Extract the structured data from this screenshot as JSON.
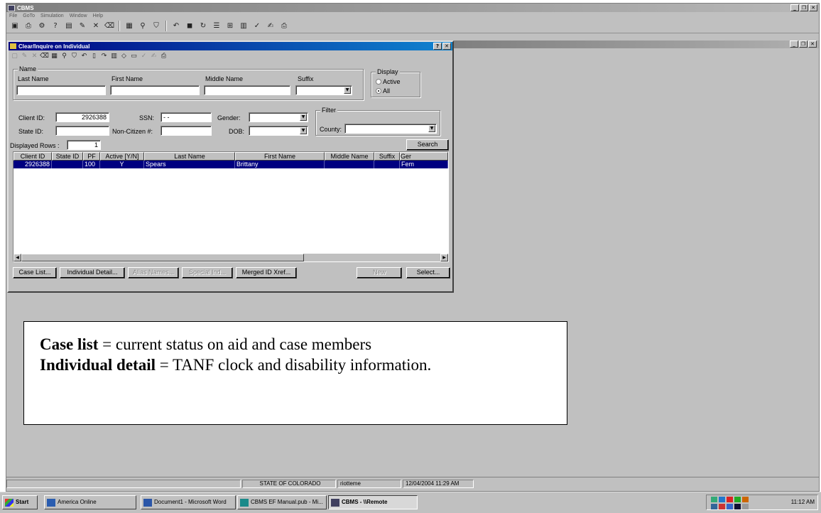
{
  "app": {
    "title": "CBMS",
    "menu": [
      "File",
      "GoTo",
      "Simulation",
      "Window",
      "Help"
    ],
    "toolbar_icons": [
      "new-icon",
      "print-preview-icon",
      "tools-icon",
      "help-icon",
      "document-icon",
      "edit-icon",
      "delete-icon",
      "clear-icon",
      "save-icon",
      "find-icon",
      "filter-icon",
      "undo-icon",
      "stop-icon",
      "refresh-icon",
      "list-icon",
      "tree-icon",
      "grid-icon",
      "check-icon",
      "spell-icon",
      "printer-icon"
    ]
  },
  "dialog": {
    "title": "Clear/Inquire on Individual",
    "name_group": "Name",
    "last_name_label": "Last Name",
    "first_name_label": "First Name",
    "middle_name_label": "Middle Name",
    "suffix_label": "Suffix",
    "display_group": "Display",
    "display_active": "Active",
    "display_all": "All",
    "client_id_label": "Client ID:",
    "client_id_value": "2926388",
    "ssn_label": "SSN:",
    "ssn_value": "- -",
    "gender_label": "Gender:",
    "filter_group": "Filter",
    "state_id_label": "State ID:",
    "non_citizen_label": "Non-Citizen #:",
    "dob_label": "DOB:",
    "county_label": "County:",
    "displayed_rows_label": "Displayed Rows :",
    "displayed_rows_value": "1",
    "search_button": "Search",
    "columns": [
      "Client ID",
      "State ID",
      "PF",
      "Active [Y/N]",
      "Last Name",
      "First Name",
      "Middle Name",
      "Suffix",
      "Ger"
    ],
    "row": {
      "client_id": "2926388",
      "state_id": "",
      "pf": "100",
      "active": "Y",
      "last_name": "Spears",
      "first_name": "Brittany",
      "middle_name": "",
      "suffix": "",
      "gender": "Fem"
    },
    "buttons": {
      "case_list": "Case List...",
      "individual_detail": "Individual Detail...",
      "alias_names": "Alias Names...",
      "special_ind": "Special Ind...",
      "merged_id": "Merged ID Xref...",
      "new": "New",
      "select": "Select..."
    }
  },
  "annotation": {
    "line1_bold": "Case list",
    "line1_rest": " = current status on aid and case members",
    "line2_bold": "Individual detail",
    "line2_rest": " = TANF clock and disability information."
  },
  "status": {
    "state": "STATE OF COLORADO",
    "user": "riotteme",
    "datetime": "12/04/2004 11:29 AM"
  },
  "taskbar": {
    "start": "Start",
    "items": [
      "America Online",
      "Document1 - Microsoft Word",
      "CBMS EF Manual.pub - Mi...",
      "CBMS - \\\\Remote"
    ],
    "clock": "11:12 AM"
  }
}
